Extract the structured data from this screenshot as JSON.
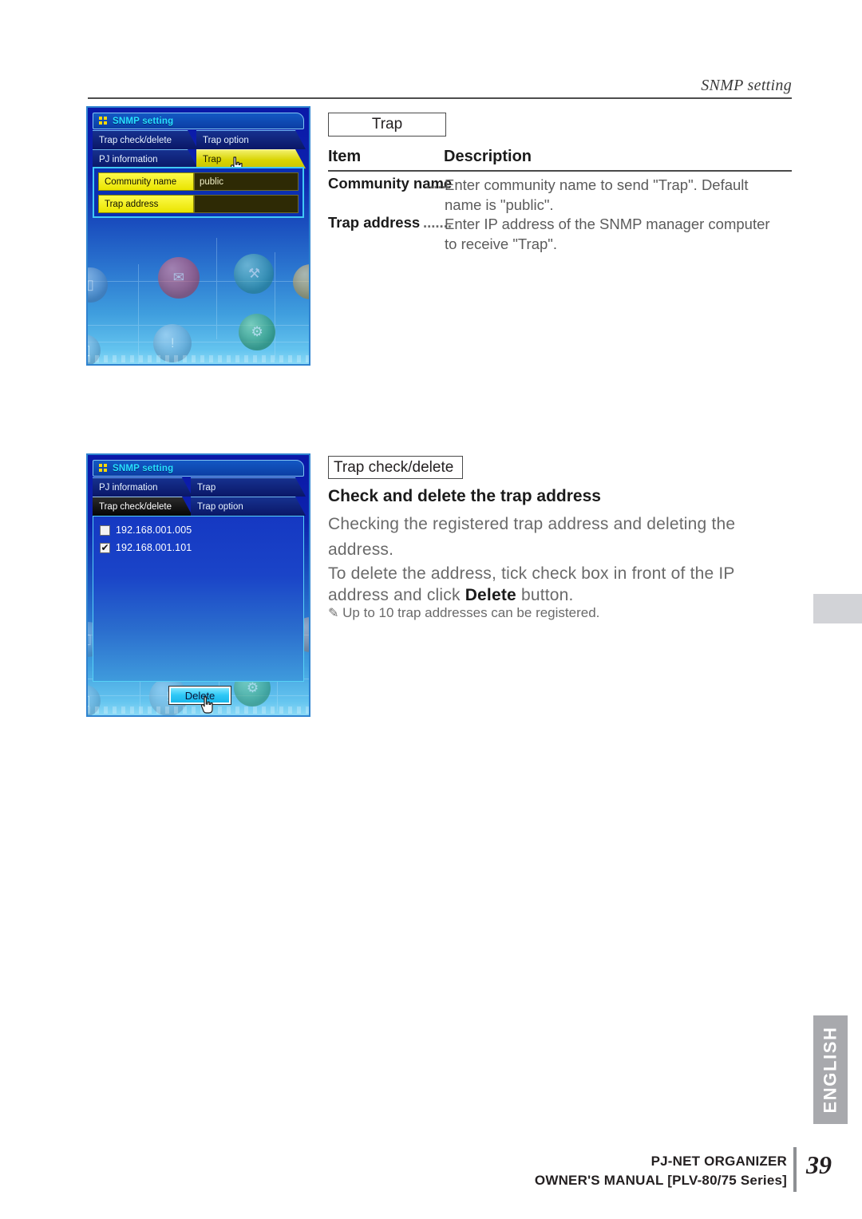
{
  "header": {
    "running_head": "SNMP setting"
  },
  "screenshot_trap": {
    "window_title": "SNMP setting",
    "tabs_row1": [
      {
        "label": "Trap check/delete",
        "state": "inactive"
      },
      {
        "label": "Trap option",
        "state": "inactive"
      }
    ],
    "tabs_row2": [
      {
        "label": "PJ information",
        "state": "inactive"
      },
      {
        "label": "Trap",
        "state": "active"
      }
    ],
    "fields": [
      {
        "label": "Community name",
        "value": "public"
      },
      {
        "label": "Trap address",
        "value": ""
      }
    ],
    "cursor": "hand-cursor"
  },
  "screenshot_trap_check": {
    "window_title": "SNMP setting",
    "tabs_row1": [
      {
        "label": "PJ information",
        "state": "inactive"
      },
      {
        "label": "Trap",
        "state": "inactive"
      }
    ],
    "tabs_row2": [
      {
        "label": "Trap check/delete",
        "state": "active"
      },
      {
        "label": "Trap option",
        "state": "inactive"
      }
    ],
    "addresses": [
      {
        "value": "192.168.001.005",
        "checked": false
      },
      {
        "value": "192.168.001.101",
        "checked": true
      }
    ],
    "delete_button": "Delete",
    "cursor": "hand-cursor"
  },
  "section_trap": {
    "callout": "Trap",
    "table": {
      "col_item": "Item",
      "col_description": "Description",
      "rows": [
        {
          "item": "Community name",
          "dots": "......",
          "description_line1": "Enter community name to send \"Trap\". Default",
          "description_line2": "name is \"public\"."
        },
        {
          "item": "Trap address",
          "dots": ".......",
          "description_line1": "Enter IP address of the SNMP manager computer",
          "description_line2": "to receive \"Trap\"."
        }
      ]
    }
  },
  "section_trap_check": {
    "callout": "Trap check/delete",
    "heading": "Check and delete the trap address",
    "paragraph1_line1": "Checking the registered trap address and deleting the",
    "paragraph1_line2": "address.",
    "paragraph2_line1": "To delete the address, tick check box in front of the IP",
    "paragraph2_line2_pre": "address and click ",
    "paragraph2_line2_bold": "Delete",
    "paragraph2_line2_post": " button.",
    "note_icon": "pencil-icon",
    "note": "Up to 10 trap addresses can be registered."
  },
  "sidebar": {
    "language_tab": "ENGLISH"
  },
  "footer": {
    "line1": "PJ-NET ORGANIZER",
    "line2": "OWNER'S MANUAL [PLV-80/75 Series]",
    "page_number": "39"
  },
  "colors": {
    "accent_blue": "#0b2fb2",
    "tab_yellow": "#eae400",
    "cyan_border": "#41c9f5",
    "gray_tab": "#d2d3d7",
    "lang_tab": "#a8a9ad"
  }
}
